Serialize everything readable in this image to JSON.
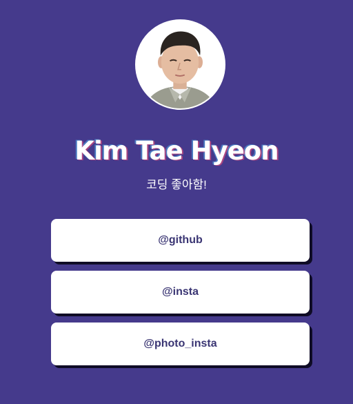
{
  "profile": {
    "avatar_alt": "profile-photo",
    "name": "Kim Tae Hyeon",
    "bio": "코딩 좋아함!"
  },
  "links": [
    {
      "label": "@github"
    },
    {
      "label": "@insta"
    },
    {
      "label": "@photo_insta"
    }
  ],
  "colors": {
    "background": "#453A8C",
    "card": "#FFFFFF",
    "link_text": "#3A3573",
    "shadow": "#0F0C26"
  }
}
